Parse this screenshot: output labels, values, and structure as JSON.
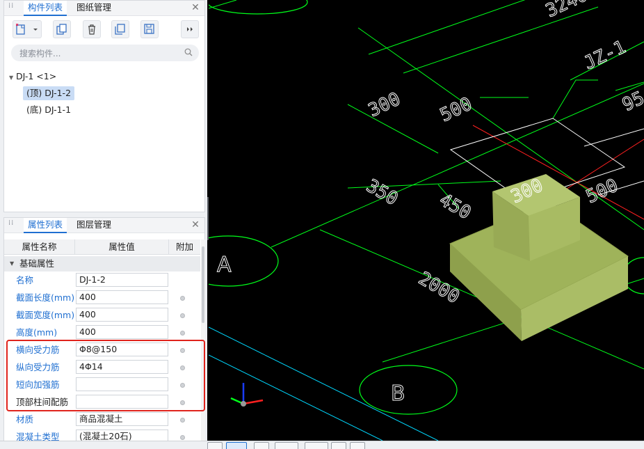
{
  "component_panel": {
    "tabs": [
      "构件列表",
      "图纸管理"
    ],
    "search_placeholder": "搜索构件...",
    "tree": {
      "root": "DJ-1 <1>",
      "children": [
        "(顶) DJ-1-2",
        "(底) DJ-1-1"
      ],
      "selected_index": 0
    }
  },
  "property_panel": {
    "tabs": [
      "属性列表",
      "图层管理"
    ],
    "columns": [
      "属性名称",
      "属性值",
      "附加"
    ],
    "group": "基础属性",
    "rows": [
      {
        "name": "名称",
        "value": "DJ-1-2"
      },
      {
        "name": "截面长度(mm)",
        "value": "400"
      },
      {
        "name": "截面宽度(mm)",
        "value": "400"
      },
      {
        "name": "高度(mm)",
        "value": "400"
      },
      {
        "name": "横向受力筋",
        "value": "Φ8@150"
      },
      {
        "name": "纵向受力筋",
        "value": "4Φ14"
      },
      {
        "name": "短向加强筋",
        "value": ""
      },
      {
        "name": "顶部柱间配筋",
        "value": ""
      },
      {
        "name": "材质",
        "value": "商品混凝土"
      },
      {
        "name": "混凝土类型",
        "value": "(混凝土20石)"
      }
    ]
  },
  "viewport": {
    "axis_labels": {
      "a": "A",
      "b": "B"
    },
    "dimensions": {
      "d300a": "300",
      "d500a": "500",
      "d350": "350",
      "d450": "450",
      "d2000": "2000",
      "d300b": "300",
      "d500b": "500",
      "d3240": "3240",
      "d95": "95"
    },
    "column_label": "JZ-1",
    "colors": {
      "footing": "#a7b862",
      "grid": "#00ff1a",
      "axis_red": "#ff2020",
      "dim_white": "#ffffff",
      "cyan": "#00d8ff"
    }
  }
}
